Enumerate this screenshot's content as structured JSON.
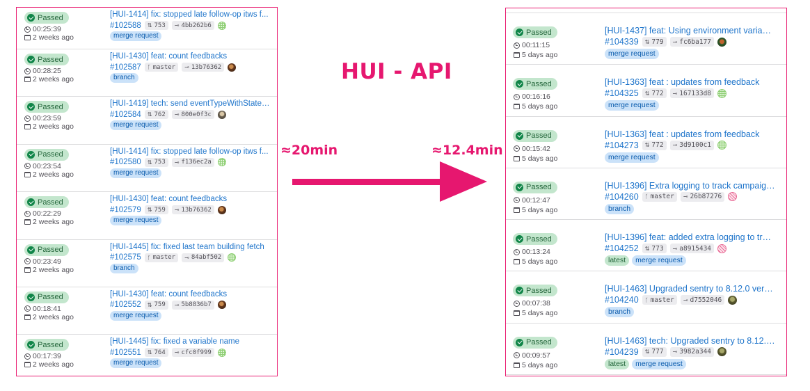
{
  "annotation": {
    "title": "HUI - API",
    "before_time": "≈20min",
    "after_time": "≈12.4min",
    "accent_color": "#e6176f"
  },
  "left_pipelines": [
    {
      "status": "Passed",
      "duration": "00:25:39",
      "age": "2 weeks ago",
      "title": "[HUI-1414] fix: stopped late follow-op itws f...",
      "id": "#102588",
      "ref_type": "mr",
      "ref": "753",
      "sha": "4bb262b6",
      "avatar": "green-grid",
      "badges": [
        "merge request"
      ]
    },
    {
      "status": "Passed",
      "duration": "00:28:25",
      "age": "2 weeks ago",
      "title": "[HUI-1430] feat: count feedbacks",
      "id": "#102587",
      "ref_type": "branch",
      "ref": "master",
      "sha": "13b76362",
      "avatar": "brown",
      "badges": [
        "branch"
      ]
    },
    {
      "status": "Passed",
      "duration": "00:23:59",
      "age": "2 weeks ago",
      "title": "[HUI-1419] tech: send eventTypeWithStates ...",
      "id": "#102584",
      "ref_type": "mr",
      "ref": "762",
      "sha": "800e0f3c",
      "avatar": "grey",
      "badges": [
        "merge request"
      ]
    },
    {
      "status": "Passed",
      "duration": "00:23:54",
      "age": "2 weeks ago",
      "title": "[HUI-1414] fix: stopped late follow-op itws f...",
      "id": "#102580",
      "ref_type": "mr",
      "ref": "753",
      "sha": "f136ec2a",
      "avatar": "green-grid",
      "badges": [
        "merge request"
      ]
    },
    {
      "status": "Passed",
      "duration": "00:22:29",
      "age": "2 weeks ago",
      "title": "[HUI-1430] feat: count feedbacks",
      "id": "#102579",
      "ref_type": "mr",
      "ref": "759",
      "sha": "13b76362",
      "avatar": "brown",
      "badges": [
        "merge request"
      ]
    },
    {
      "status": "Passed",
      "duration": "00:23:49",
      "age": "2 weeks ago",
      "title": "[HUI-1445] fix: fixed last team building fetch",
      "id": "#102575",
      "ref_type": "branch",
      "ref": "master",
      "sha": "84abf502",
      "avatar": "green-grid",
      "badges": [
        "branch"
      ]
    },
    {
      "status": "Passed",
      "duration": "00:18:41",
      "age": "2 weeks ago",
      "title": "[HUI-1430] feat: count feedbacks",
      "id": "#102552",
      "ref_type": "mr",
      "ref": "759",
      "sha": "5b8836b7",
      "avatar": "brown",
      "badges": [
        "merge request"
      ]
    },
    {
      "status": "Passed",
      "duration": "00:17:39",
      "age": "2 weeks ago",
      "title": "[HUI-1445] fix: fixed a variable name",
      "id": "#102551",
      "ref_type": "mr",
      "ref": "764",
      "sha": "cfc0f999",
      "avatar": "green-grid",
      "badges": [
        "merge request"
      ]
    }
  ],
  "right_pipelines": [
    {
      "status": "Passed",
      "duration": "00:11:15",
      "age": "5 days ago",
      "title": "[HUI-1437] feat: Using environment variable...",
      "id": "#104339",
      "ref_type": "mr",
      "ref": "779",
      "sha": "fc6ba177",
      "avatar": "dark-green",
      "badges": [
        "merge request"
      ]
    },
    {
      "status": "Passed",
      "duration": "00:16:16",
      "age": "5 days ago",
      "title": "[HUI-1363] feat : updates from feedback",
      "id": "#104325",
      "ref_type": "mr",
      "ref": "772",
      "sha": "167133d8",
      "avatar": "green-grid",
      "badges": [
        "merge request"
      ]
    },
    {
      "status": "Passed",
      "duration": "00:15:42",
      "age": "5 days ago",
      "title": "[HUI-1363] feat : updates from feedback",
      "id": "#104273",
      "ref_type": "mr",
      "ref": "772",
      "sha": "3d9100c1",
      "avatar": "green-grid",
      "badges": [
        "merge request"
      ]
    },
    {
      "status": "Passed",
      "duration": "00:12:47",
      "age": "5 days ago",
      "title": "[HUI-1396] Extra logging to track campaign ...",
      "id": "#104260",
      "ref_type": "branch",
      "ref": "master",
      "sha": "26b87276",
      "avatar": "pink-grid",
      "badges": [
        "branch"
      ]
    },
    {
      "status": "Passed",
      "duration": "00:13:24",
      "age": "5 days ago",
      "title": "[HUI-1396] feat: added extra logging to trac...",
      "id": "#104252",
      "ref_type": "mr",
      "ref": "773",
      "sha": "a8915434",
      "avatar": "pink-grid",
      "badges": [
        "latest",
        "merge request"
      ]
    },
    {
      "status": "Passed",
      "duration": "00:07:38",
      "age": "5 days ago",
      "title": "[HUI-1463] Upgraded sentry to 8.12.0 versio...",
      "id": "#104240",
      "ref_type": "branch",
      "ref": "master",
      "sha": "d7552046",
      "avatar": "olive",
      "badges": [
        "branch"
      ]
    },
    {
      "status": "Passed",
      "duration": "00:09:57",
      "age": "5 days ago",
      "title": "[HUI-1463] tech: Upgraded sentry to 8.12.0 ...",
      "id": "#104239",
      "ref_type": "mr",
      "ref": "777",
      "sha": "3982a344",
      "avatar": "olive",
      "badges": [
        "latest",
        "merge request"
      ]
    }
  ]
}
